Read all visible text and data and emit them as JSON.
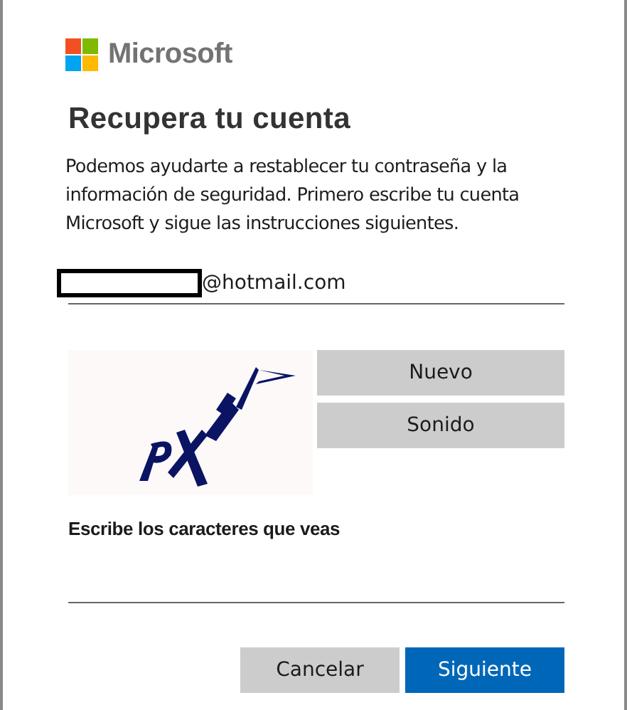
{
  "brand": {
    "name": "Microsoft"
  },
  "title": "Recupera tu cuenta",
  "description": "Podemos ayudarte a restablecer tu contraseña y la información de seguridad. Primero escribe tu cuenta Microsoft y sigue las instrucciones siguientes.",
  "email_field": {
    "value": "@hotmail.com",
    "redacted": true
  },
  "captcha": {
    "buttons": [
      "Nuevo",
      "Sonido"
    ],
    "label": "Escribe los caracteres que veas"
  },
  "buttons": [
    {
      "label": "Cancelar",
      "kind": "secondary"
    },
    {
      "label": "Siguiente",
      "kind": "primary"
    }
  ]
}
